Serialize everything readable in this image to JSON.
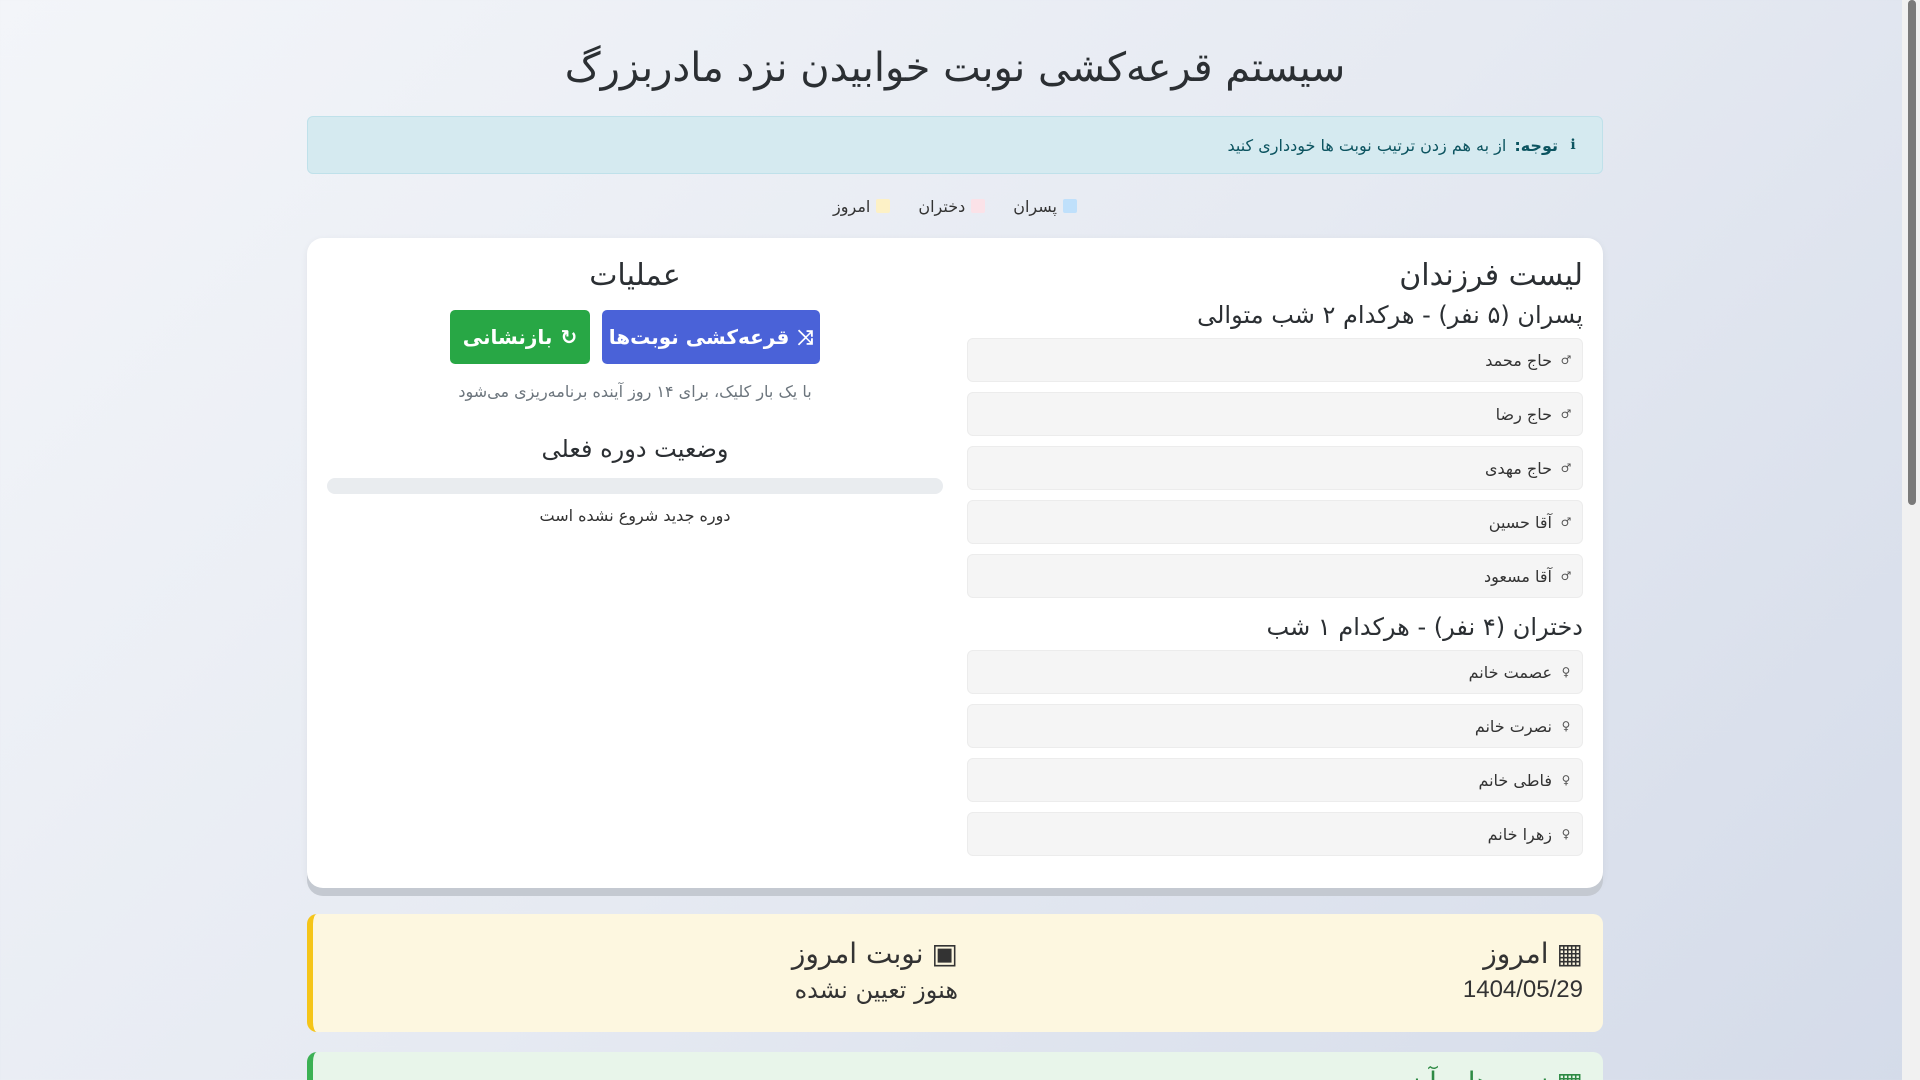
{
  "title": "سیستم قرعه‌کشی نوبت خوابیدن نزد مادربزرگ",
  "alert": {
    "icon": "info-icon",
    "bold": "توجه:",
    "text": "از به هم زدن ترتیب نوبت ها خودداری کنید"
  },
  "legend": [
    {
      "label": "پسران",
      "color": "#bfe0fb"
    },
    {
      "label": "دختران",
      "color": "#fbe2e8"
    },
    {
      "label": "امروز",
      "color": "#fdf1c6"
    }
  ],
  "kids": {
    "title": "لیست فرزندان",
    "boys_title": "پسران (۵ نفر) - هرکدام ۲ شب متوالی",
    "boys": [
      "حاج محمد",
      "حاج رضا",
      "حاج مهدی",
      "آقا حسین",
      "آقا مسعود"
    ],
    "girls_title": "دختران (۴ نفر) - هرکدام ۱ شب",
    "girls": [
      "عصمت خانم",
      "نصرت خانم",
      "فاطی خانم",
      "زهرا خانم"
    ]
  },
  "ops": {
    "title": "عملیات",
    "draw_label": "قرعه‌کشی نوبت‌ها",
    "reset_label": "بازنشانی",
    "hint": "با یک بار کلیک، برای ۱۴ روز آینده برنامه‌ریزی می‌شود",
    "status_title": "وضعیت دوره فعلی",
    "progress": 0,
    "status_text": "دوره جدید شروع نشده است"
  },
  "today": {
    "label": "امروز",
    "date": "1404/05/29",
    "turn_label": "نوبت امروز",
    "turn_value": "هنوز تعیین نشده"
  },
  "future": {
    "label": "نوبت‌های آینده"
  }
}
